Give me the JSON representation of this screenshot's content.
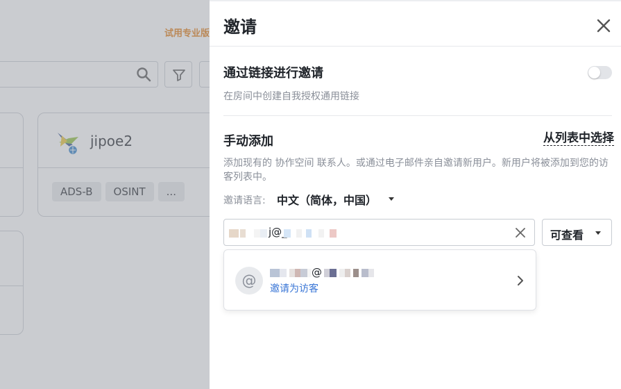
{
  "background": {
    "trial_text": "试用专业版",
    "card": {
      "name": "jipoe2",
      "tags": [
        "ADS-B",
        "OSINT",
        "..."
      ]
    }
  },
  "panel": {
    "title": "邀请",
    "link_section": {
      "title": "通过链接进行邀请",
      "description": "在房间中创建自我授权通用链接",
      "toggle_on": false
    },
    "manual_section": {
      "title": "手动添加",
      "from_list": "从列表中选择",
      "description": "添加现有的 协作空间 联系人。或通过电子邮件亲自邀请新用户。新用户将被添加到您的访客列表中。",
      "language_label": "邀请语言:",
      "language_value": "中文（简体，中国）"
    },
    "email_input": {
      "value_visible": "j@_"
    },
    "permission": {
      "value": "可查看"
    },
    "suggestion": {
      "email_visible": "@",
      "subtitle": "邀请为访客"
    }
  },
  "icons": {
    "close": "close-icon",
    "clear": "clear-icon",
    "at": "at-icon",
    "chevron": "chevron-right-icon",
    "search": "search-icon",
    "filter": "filter-icon"
  },
  "colors": {
    "accent_blue": "#3875d6",
    "trial_orange": "#e0780f",
    "overlay": "#cdcfd3"
  }
}
